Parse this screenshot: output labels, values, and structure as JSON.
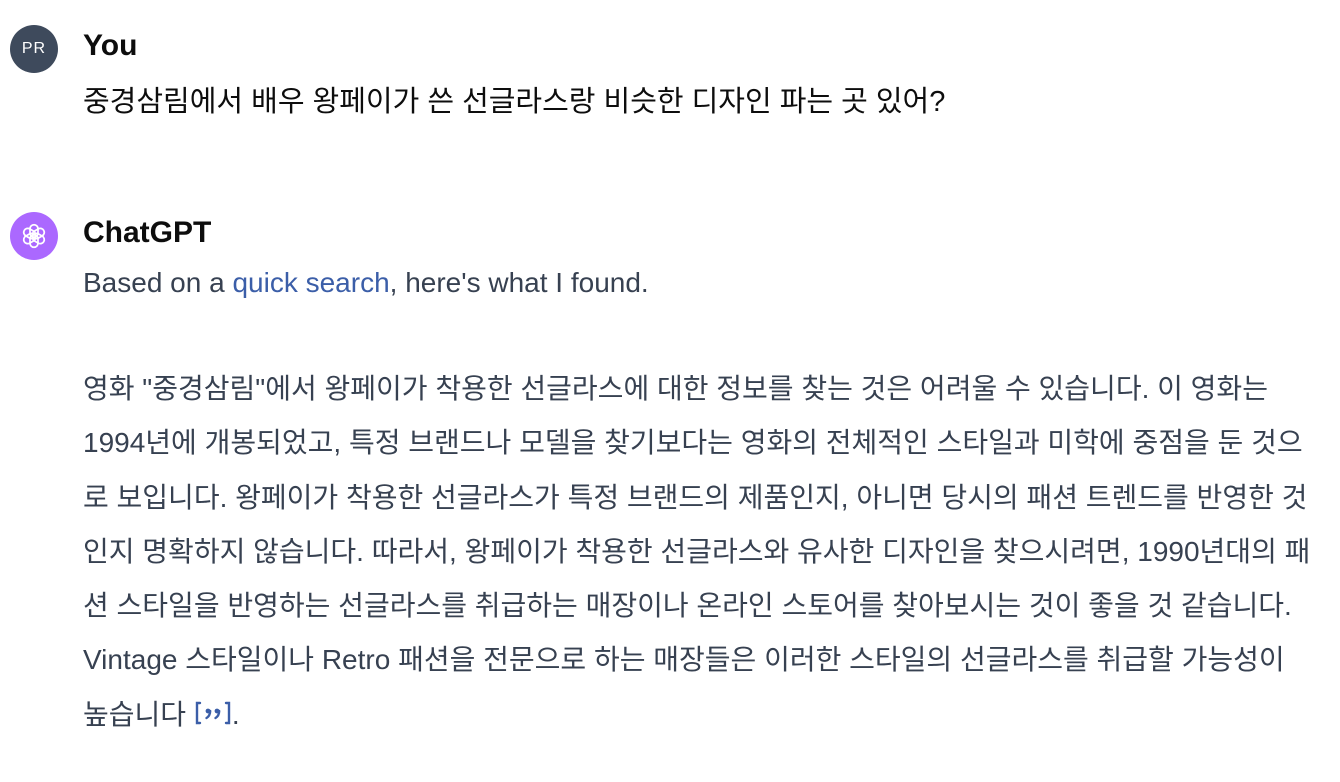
{
  "user_message": {
    "avatar_initials": "PR",
    "author": "You",
    "text": "중경삼림에서 배우 왕페이가 쓴 선글라스랑 비슷한 디자인 파는 곳 있어?"
  },
  "assistant_message": {
    "author": "ChatGPT",
    "intro_before_link": "Based on a ",
    "intro_link": "quick search",
    "intro_after_link": ", here's what I found.",
    "body": "영화 \"중경삼림\"에서 왕페이가 착용한 선글라스에 대한 정보를 찾는 것은 어려울 수 있습니다. 이 영화는 1994년에 개봉되었고, 특정 브랜드나 모델을 찾기보다는 영화의 전체적인 스타일과 미학에 중점을 둔 것으로 보입니다. 왕페이가 착용한 선글라스가 특정 브랜드의 제품인지, 아니면 당시의 패션 트렌드를 반영한 것인지 명확하지 않습니다. 따라서, 왕페이가 착용한 선글라스와 유사한 디자인을 찾으시려면, 1990년대의 패션 스타일을 반영하는 선글라스를 취급하는 매장이나 온라인 스토어를 찾아보시는 것이 좋을 것 같습니다. Vintage 스타일이나 Retro 패션을 전문으로 하는 매장들은 이러한 스타일의 선글라스를 취급할 가능성이 높습니다",
    "body_end": "."
  },
  "colors": {
    "user_avatar_bg": "#3e4a5c",
    "gpt_avatar_bg": "#ab68ff",
    "link": "#3b5ea8",
    "body_text": "#374151"
  },
  "icons": {
    "gpt_avatar": "openai-logo-icon",
    "citation": "quote-citation-icon"
  }
}
